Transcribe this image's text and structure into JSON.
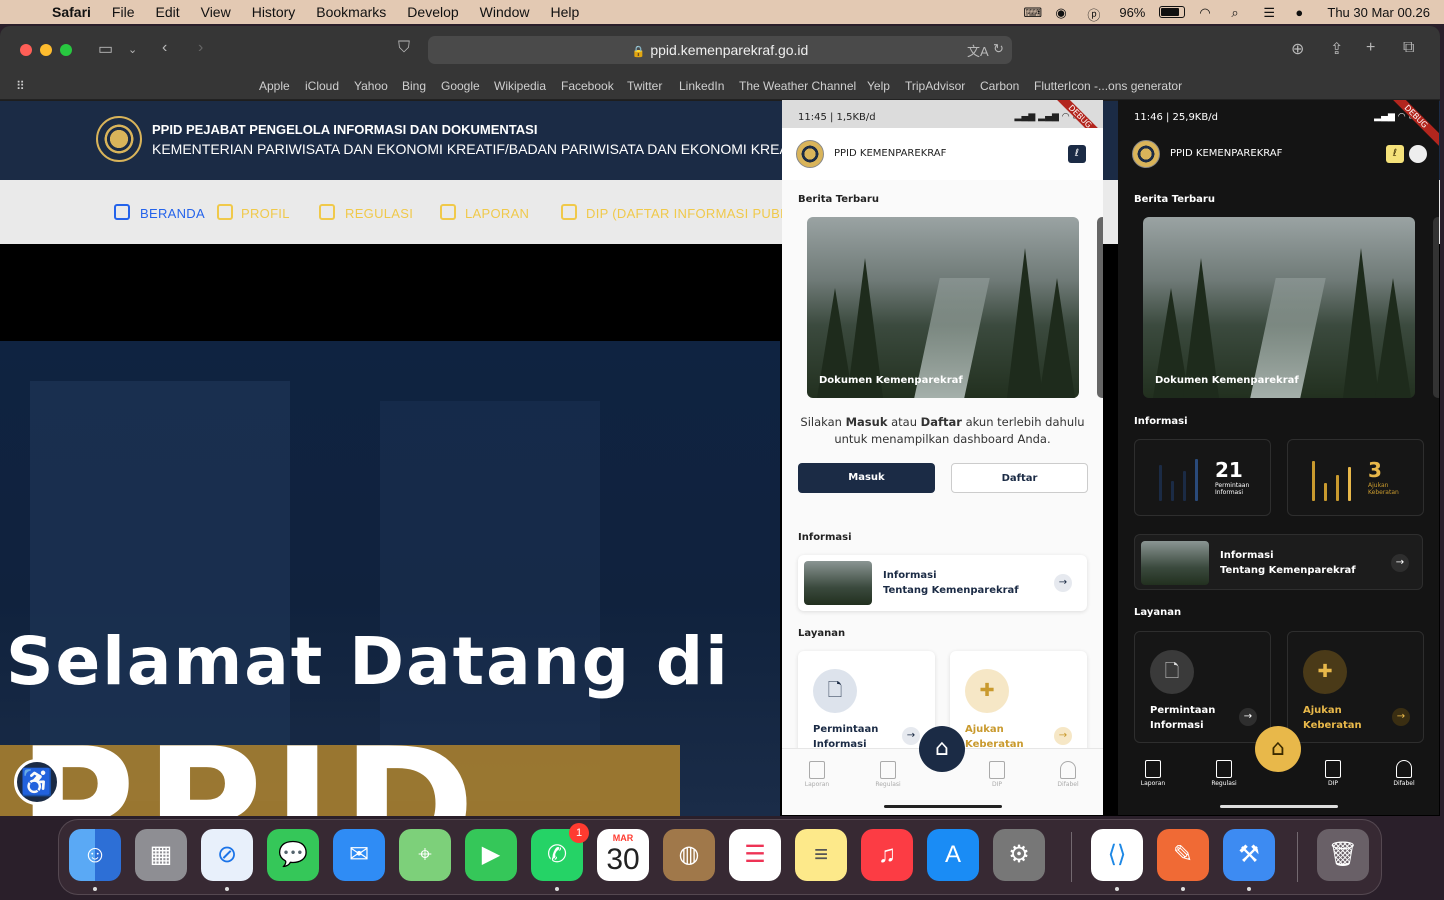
{
  "menubar": {
    "app": "Safari",
    "items": [
      "File",
      "Edit",
      "View",
      "History",
      "Bookmarks",
      "Develop",
      "Window",
      "Help"
    ],
    "battery": "96%",
    "clock": "Thu 30 Mar  00.26"
  },
  "browser": {
    "url": "ppid.kemenparekraf.go.id",
    "bookmarks": [
      "Apple",
      "iCloud",
      "Yahoo",
      "Bing",
      "Google",
      "Wikipedia",
      "Facebook",
      "Twitter",
      "LinkedIn",
      "The Weather Channel",
      "Yelp",
      "TripAdvisor",
      "Carbon",
      "FlutterIcon -...ons generator"
    ]
  },
  "site": {
    "title_line1": "PPID PEJABAT PENGELOLA INFORMASI DAN DOKUMENTASI",
    "title_line2": "KEMENTERIAN PARIWISATA DAN EKONOMI KREATIF/BADAN PARIWISATA DAN EKONOMI KREATIF",
    "nav": [
      "BERANDA",
      "PROFIL",
      "REGULASI",
      "LAPORAN",
      "DIP (DAFTAR INFORMASI PUBLIK)"
    ],
    "hero_line1": "Selamat Datang di",
    "hero_line2": "PPID"
  },
  "phone_light": {
    "status": "11:45 | 1,5KB/d",
    "debug": "DEBUG",
    "app_title": "PPID KEMENPAREKRAF",
    "news_heading": "Berita Terbaru",
    "news_caption": "Dokumen Kemenparekraf",
    "login_prefix": "Silakan ",
    "login_masuk": "Masuk",
    "login_mid": " atau ",
    "login_daftar": "Daftar",
    "login_suffix": " akun terlebih dahulu untuk menampilkan dashboard Anda.",
    "btn_masuk": "Masuk",
    "btn_daftar": "Daftar",
    "info_heading": "Informasi",
    "info_card_line1": "Informasi",
    "info_card_line2": "Tentang Kemenparekraf",
    "services_heading": "Layanan",
    "service1_line1": "Permintaan",
    "service1_line2": "Informasi",
    "service2_line1": "Ajukan",
    "service2_line2": "Keberatan",
    "nav": [
      "Laporan",
      "Regulasi",
      "DIP",
      "Difabel"
    ]
  },
  "phone_dark": {
    "status": "11:46 | 25,9KB/d",
    "debug": "DEBUG",
    "app_title": "PPID KEMENPAREKRAF",
    "news_heading": "Berita Terbaru",
    "news_caption": "Dokumen Kemenparekraf",
    "info_heading": "Informasi",
    "stat1_num": "21",
    "stat1_label": "Permintaan Informasi",
    "stat2_num": "3",
    "stat2_label": "Ajukan Keberatan",
    "info_card_line1": "Informasi",
    "info_card_line2": "Tentang Kemenparekraf",
    "services_heading": "Layanan",
    "service1_line1": "Permintaan",
    "service1_line2": "Informasi",
    "service2_line1": "Ajukan",
    "service2_line2": "Keberatan",
    "nav": [
      "Laporan",
      "Regulasi",
      "DIP",
      "Difabel"
    ]
  },
  "dock": {
    "calendar_month": "MAR",
    "calendar_day": "30",
    "whatsapp_badge": "1",
    "apps": [
      "Finder",
      "Launchpad",
      "Safari",
      "Messages",
      "Mail",
      "Maps",
      "FaceTime",
      "WhatsApp",
      "Calendar",
      "Contacts",
      "Reminders",
      "Notes",
      "Music",
      "App Store",
      "System Settings",
      "Visual Studio Code",
      "Brush",
      "Xcode",
      "Trash"
    ]
  },
  "colors": {
    "navy": "#1b2b45",
    "gold": "#e8b84a",
    "link_blue": "#2463eb"
  }
}
